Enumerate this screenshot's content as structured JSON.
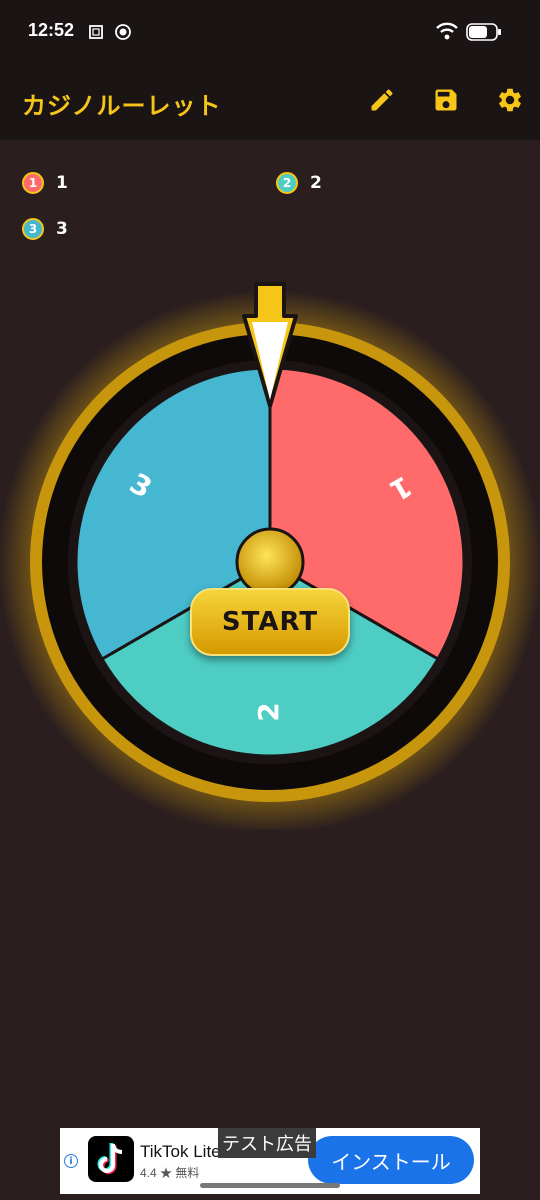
{
  "status_bar": {
    "time": "12:52"
  },
  "app_bar": {
    "title": "カジノルーレット",
    "icons": [
      "pencil-icon",
      "save-icon",
      "settings-gear-icon"
    ]
  },
  "legend": [
    {
      "number": "1",
      "label": "1",
      "color": "#ff6b6b"
    },
    {
      "number": "2",
      "label": "2",
      "color": "#4ecdc4"
    },
    {
      "number": "3",
      "label": "3",
      "color": "#45b7d1"
    }
  ],
  "wheel": {
    "segments": [
      {
        "label": "1",
        "color": "#ff6b6b"
      },
      {
        "label": "2",
        "color": "#4ecdc4"
      },
      {
        "label": "3",
        "color": "#45b7d1"
      }
    ],
    "rim_color": "#c8960c",
    "pointer_color": "#f5c518"
  },
  "start_button": {
    "label": "START"
  },
  "ad": {
    "test_label": "テスト広告",
    "app_name": "TikTok Lite",
    "rating": "4.4 ★ 無料",
    "install_label": "インストール"
  },
  "colors": {
    "accent": "#f5c518",
    "background": "#2a1e1f",
    "bar": "#1b1414"
  }
}
